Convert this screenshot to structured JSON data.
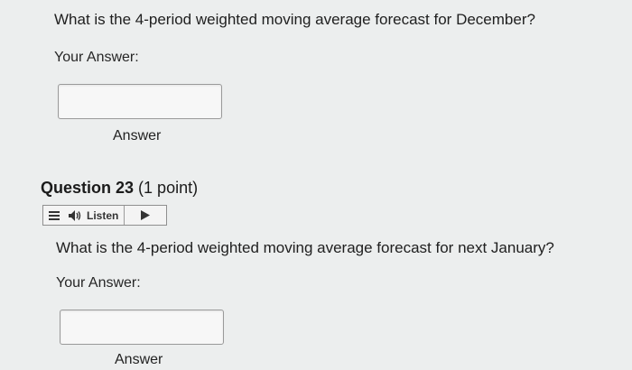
{
  "question22": {
    "prompt": "What is the 4-period weighted moving average forecast for December?",
    "your_answer_label": "Your Answer:",
    "input_value": "",
    "answer_button": "Answer"
  },
  "question23": {
    "title": "Question 23",
    "points": "(1 point)",
    "listen_label": "Listen",
    "prompt": "What is the 4-period weighted moving average forecast for next January?",
    "your_answer_label": "Your Answer:",
    "input_value": "",
    "answer_button": "Answer"
  },
  "icons": {
    "menu": "hamburger-menu-icon",
    "speaker": "speaker-icon",
    "play": "play-icon"
  },
  "colors": {
    "background": "#eceeee",
    "input_border": "#9a9a9a",
    "text": "#1e1e1e"
  }
}
